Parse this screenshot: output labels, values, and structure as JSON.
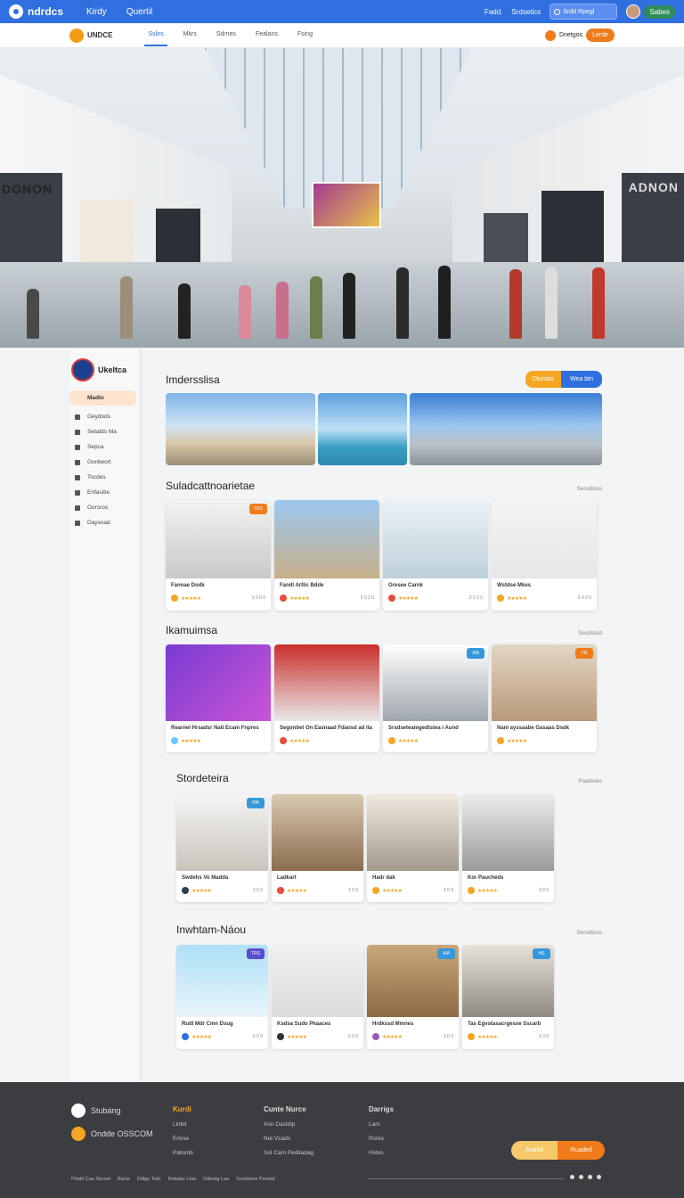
{
  "topbar": {
    "logo": "ndrdcs",
    "nav": [
      "Kirdy",
      "Quertil"
    ],
    "links": [
      "Fadd.",
      "Srdsetics"
    ],
    "search_placeholder": "Srdd Rpegl",
    "user_button": "Sabes"
  },
  "nav2": {
    "brand": "UNDCE",
    "links": [
      "Ssles",
      "Mkrs",
      "Sdrnes",
      "Fealans",
      "Fsing"
    ],
    "right_label": "Dnetgos",
    "right_button": "Lerde"
  },
  "hero": {
    "sign_left": "DONON",
    "sign_right": "ADNON"
  },
  "sidebar": {
    "brand": "Ukeltca",
    "active_item": "Madlo",
    "items": [
      "Geydods",
      "Setatds Ma",
      "Sepca",
      "Gonkeort",
      "Tocdes",
      "Enfasitie",
      "Gorsros",
      "Daysnad"
    ]
  },
  "top": {
    "title": "Imdersslisa",
    "btn1": "Dtuntas",
    "btn2": "Wea btn"
  },
  "sections": [
    {
      "title": "Suladcattnoarietae",
      "link": "Sersdloss",
      "cards": [
        {
          "name": "Fanoae Dodk",
          "num": "0 0 0 0",
          "badge": "TRS",
          "badge_color": "#f07b1a",
          "av_color": "#f5a623"
        },
        {
          "name": "Fandl Artlic Bdde",
          "num": "5 0 3 0",
          "badge": "",
          "badge_color": "",
          "av_color": "#e74c3c"
        },
        {
          "name": "Gresee Carnk",
          "num": "3 0 3 0",
          "badge": "",
          "badge_color": "",
          "av_color": "#e74c3c"
        },
        {
          "name": "Wstdse Mkes",
          "num": "5 0 3 0",
          "badge": "",
          "badge_color": "",
          "av_color": "#f5a623"
        }
      ]
    },
    {
      "title": "Ikamuimsa",
      "link": "Sesdslod",
      "cards": [
        {
          "name": "Rearnel Hrsadsr Nati Ecam Fnpres",
          "num": "",
          "badge": "",
          "badge_color": "",
          "av_color": "#6ec6ff"
        },
        {
          "name": "Segonbet On Easnaad Fdaosd ad ita",
          "num": "",
          "badge": "",
          "badge_color": "",
          "av_color": "#e74c3c"
        },
        {
          "name": "Srsdseteamgedtstea i Aund",
          "num": "",
          "badge": "AM",
          "badge_color": "#3498db",
          "av_color": "#f5a623"
        },
        {
          "name": "Nanl ayssaabe Gasaas Dsdk",
          "num": "",
          "badge": "TR",
          "badge_color": "#f07b1a",
          "av_color": "#f5a623"
        }
      ]
    },
    {
      "title": "Stordeteira",
      "link": "Paadsies",
      "cards": [
        {
          "name": "Swdehs Vo Madda",
          "num": "3 0 0",
          "badge": "IPA",
          "badge_color": "#3498db",
          "av_color": "#2c3e50"
        },
        {
          "name": "Ladkart",
          "num": "3 0 0",
          "badge": "",
          "badge_color": "",
          "av_color": "#e74c3c"
        },
        {
          "name": "Hadr dak",
          "num": "3 0 0",
          "badge": "",
          "badge_color": "",
          "av_color": "#f5a623"
        },
        {
          "name": "Kor Paucheds",
          "num": "3 0 0",
          "badge": "",
          "badge_color": "",
          "av_color": "#f5a623"
        }
      ]
    },
    {
      "title": "Inwhtam-Náou",
      "link": "Sersdloss",
      "cards": [
        {
          "name": "Rudl Mdr Cmn Dsug",
          "num": "0 0 0",
          "badge": "TRS",
          "badge_color": "#5b4ccf",
          "av_color": "#2f6fe0"
        },
        {
          "name": "Ksdsa Sudo Pkaaces",
          "num": "0 0 0",
          "badge": "",
          "badge_color": "",
          "av_color": "#333"
        },
        {
          "name": "Hrdkssd Mmnes",
          "num": "3 0 0",
          "badge": "AM",
          "badge_color": "#3498db",
          "av_color": "#9b59b6"
        },
        {
          "name": "Tas Egvstasacrgesse Sscarb",
          "num": "3 0 0",
          "badge": "HS",
          "badge_color": "#3498db",
          "av_color": "#f5a623"
        }
      ]
    }
  ],
  "footer": {
    "brand1": "Stubáng",
    "brand2": "Ondde OSSCOM",
    "col1": {
      "head": "Kurdi",
      "links": [
        "Linkd",
        "Erlvse",
        "Patrenb"
      ]
    },
    "col2": {
      "head": "Cunte Nurce",
      "links": [
        "Aon Dastdip",
        "Nut Vcads",
        "Sol  Cam Peditadag"
      ]
    },
    "col3": {
      "head": "Darrigs",
      "links": [
        "Lars",
        "Rsres",
        "Hstes"
      ]
    },
    "cta_left": "Andbn",
    "cta_right": "Ruaded",
    "bottom": [
      "Pdald Caa Stcosd",
      "Bacia",
      "Ddtgs Tsdc",
      "Bdadae Ltaa",
      "Ddwstg Laa",
      "Scedssne Pardad"
    ]
  }
}
